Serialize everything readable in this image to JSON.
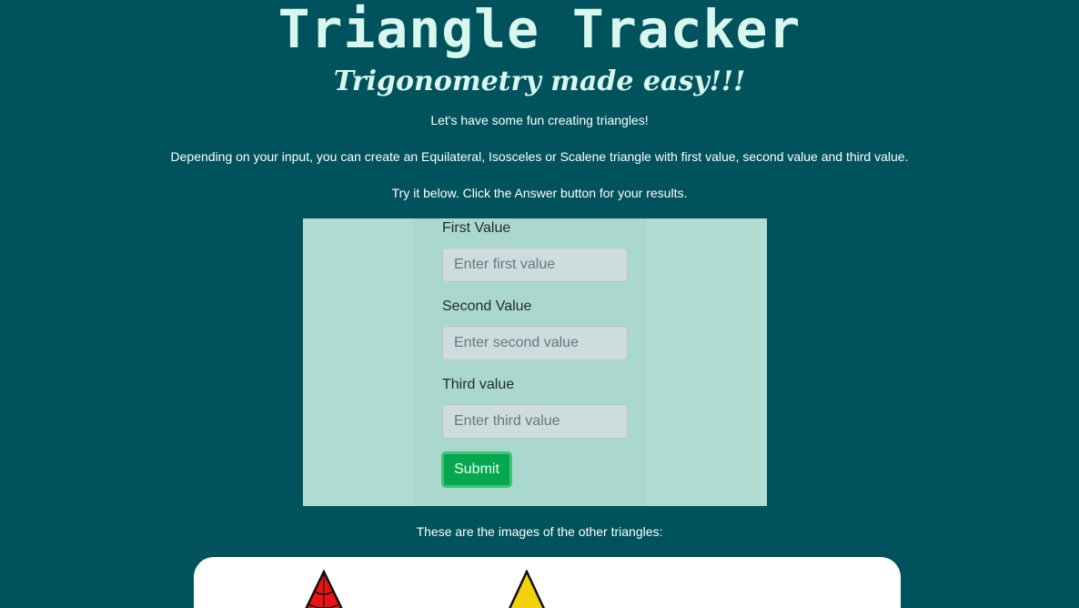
{
  "header": {
    "title": "Triangle Tracker",
    "subtitle": "Trigonometry made easy!!!"
  },
  "intro": {
    "line1": "Let's have some fun creating triangles!",
    "line2": "Depending on your input, you can create an Equilateral, Isosceles or Scalene triangle with first value, second value and third value.",
    "line3": "Try it below. Click the Answer button for your results."
  },
  "form": {
    "fields": [
      {
        "label": "First Value",
        "placeholder": "Enter first value",
        "value": ""
      },
      {
        "label": "Second Value",
        "placeholder": "Enter second value",
        "value": ""
      },
      {
        "label": "Third value",
        "placeholder": "Enter third value",
        "value": ""
      }
    ],
    "submit_label": "Submit"
  },
  "gallery": {
    "caption": "These are the images of the other triangles:",
    "images": [
      {
        "icon": "red-triangle-icon",
        "color": "#e81414"
      },
      {
        "icon": "yellow-triangle-icon",
        "color": "#f2d20c"
      }
    ]
  },
  "colors": {
    "background": "#00525c",
    "panel": "#b0dcd2",
    "accent": "#04a84f",
    "heading": "#d7f7ef"
  }
}
